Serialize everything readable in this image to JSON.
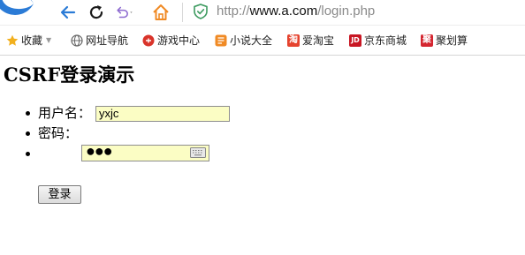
{
  "browser": {
    "url_prefix": "http://",
    "url_host": "www.a.com",
    "url_path": "/login.php"
  },
  "bookmarks": [
    {
      "label": "收藏",
      "icon": "star-icon"
    },
    {
      "label": "网址导航",
      "icon": "globe-icon"
    },
    {
      "label": "游戏中心",
      "icon": "game-icon"
    },
    {
      "label": "小说大全",
      "icon": "book-icon"
    },
    {
      "label": "爱淘宝",
      "icon": "taobao-icon",
      "badge": "淘"
    },
    {
      "label": "京东商城",
      "icon": "jd-icon",
      "badge": "JD"
    },
    {
      "label": "聚划算",
      "icon": "juhuasuan-icon",
      "badge": "聚"
    }
  ],
  "page": {
    "title": "CSRF登录演示",
    "username_label": "用户名：",
    "username_value": "yxjc",
    "password_label": "密码：",
    "password_mask": "●●●",
    "login_button": "登录"
  },
  "colors": {
    "accent_blue": "#2b7bd6",
    "autofill_yellow": "#fbfdc4",
    "home_orange": "#f08a24",
    "shield_green": "#3c9a5f"
  }
}
